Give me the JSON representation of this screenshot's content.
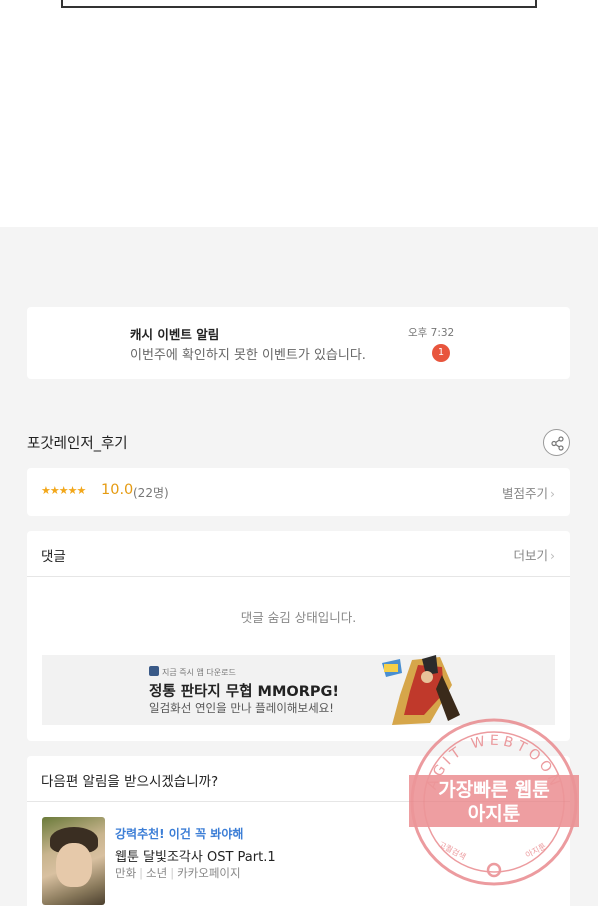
{
  "notification": {
    "title": "캐시 이벤트 알림",
    "body": "이번주에 확인하지 못한 이벤트가 있습니다.",
    "time": "오후 7:32",
    "badge": "1"
  },
  "review": {
    "title": "포갓레인저_후기",
    "share_icon": "share-icon"
  },
  "rating": {
    "stars": "★★★★★",
    "score": "10.0",
    "count": "(22명)",
    "rate_button": "별점주기",
    "chevron": "›"
  },
  "comments": {
    "header": "댓글",
    "more_button": "더보기",
    "chevron": "›",
    "empty_text": "댓글 숨김 상태입니다."
  },
  "ad": {
    "brand": "지금 즉시 앱 다운로드",
    "title": "정통 판타지 무협 MMORPG!",
    "subtitle": "일검화선 연인을 만나 플레이해보세요!"
  },
  "next_episode": {
    "header": "다음편 알림을 받으시겠습니까?",
    "recommend": "강력추천! 이건 꼭 봐야해",
    "title": "웹툰 달빛조각사 OST Part.1",
    "meta": [
      "만화",
      "소년",
      "카카오페이지"
    ]
  },
  "watermark": {
    "ring_text": "AGIT WEBTOON",
    "line1": "가장빠른 웹툰",
    "line2": "아지툰",
    "bottom_left": "고퀄검색",
    "bottom_right": "아지툰"
  },
  "colors": {
    "accent_blue": "#3c7ed6",
    "star_orange": "#f2a71a",
    "badge_red": "#e8553d",
    "stamp_red": "#e36a6a"
  }
}
